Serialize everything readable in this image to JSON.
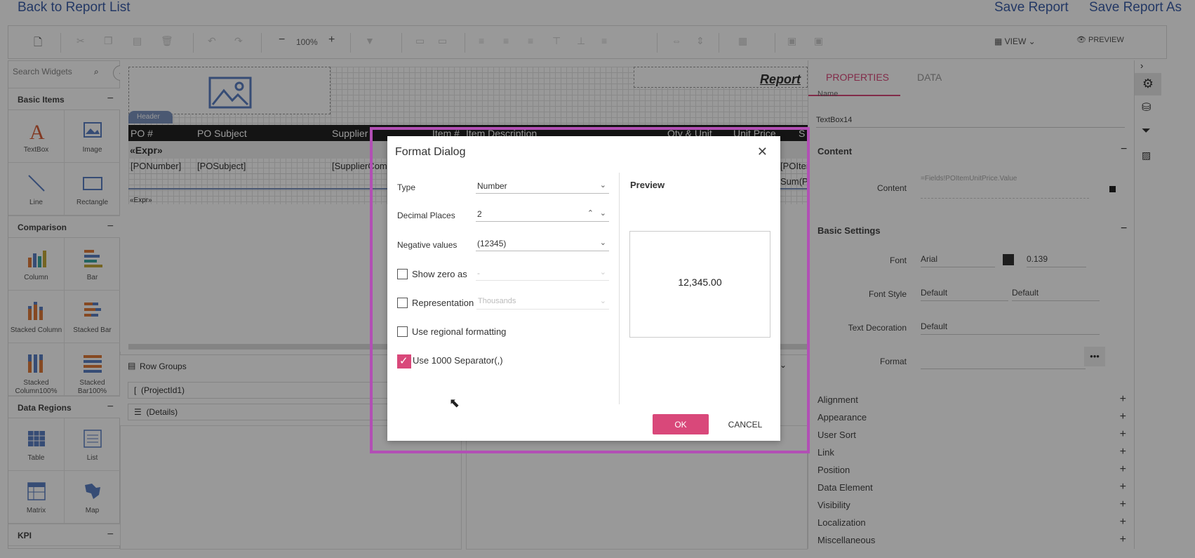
{
  "topbar": {
    "back": "Back to Report List",
    "save": "Save Report",
    "save_as": "Save Report As"
  },
  "toolbar": {
    "zoom": "100%",
    "minus": "−",
    "plus": "+",
    "view": "VIEW",
    "preview": "PREVIEW"
  },
  "left_panel": {
    "search_placeholder": "Search Widgets",
    "sections": [
      "Basic Items",
      "Comparison",
      "Data Regions",
      "KPI"
    ],
    "widgets": {
      "textbox": "TextBox",
      "image": "Image",
      "line": "Line",
      "rectangle": "Rectangle",
      "column": "Column",
      "bar": "Bar",
      "stacked_column": "Stacked Column",
      "stacked_bar": "Stacked Bar",
      "stacked_column100": "Stacked Column100%",
      "stacked_bar100": "Stacked Bar100%",
      "table": "Table",
      "list": "List",
      "matrix": "Matrix",
      "map": "Map"
    }
  },
  "canvas": {
    "report_title": "Report",
    "header_tag": "Header",
    "columns": [
      "PO #",
      "PO Subject",
      "Supplier",
      "Item #",
      "Item Description",
      "Qty & Unit",
      "Unit Price",
      "S"
    ],
    "group_row": "«Expr»",
    "detail_row": [
      "[PONumber]",
      "[POSubject]",
      "[SupplierCom",
      "[POIter"
    ],
    "sum_cell": "Sum(P",
    "footer_expr": "«Expr»"
  },
  "bottom": {
    "row_groups": "Row Groups",
    "group1": "(ProjectId1)",
    "group2": "(Details)"
  },
  "properties": {
    "tabs": [
      "PROPERTIES",
      "DATA"
    ],
    "name_label": "Name",
    "name_value": "TextBox14",
    "content_section": "Content",
    "content_label": "Content",
    "content_value": "=Fields!POItemUnitPrice.Value",
    "basic_section": "Basic Settings",
    "font_label": "Font",
    "font_value": "Arial",
    "font_size": "0.139",
    "font_style_label": "Font Style",
    "font_style_value1": "Default",
    "font_style_value2": "Default",
    "text_decoration_label": "Text Decoration",
    "text_decoration_value": "Default",
    "format_label": "Format",
    "format_btn": "•••",
    "collapsed": [
      "Alignment",
      "Appearance",
      "User Sort",
      "Link",
      "Position",
      "Data Element",
      "Visibility",
      "Localization",
      "Miscellaneous"
    ]
  },
  "dialog": {
    "title": "Format Dialog",
    "type_label": "Type",
    "type_value": "Number",
    "decimal_label": "Decimal Places",
    "decimal_value": "2",
    "negative_label": "Negative values",
    "negative_value": "(12345)",
    "show_zero_label": "Show zero as",
    "show_zero_value": "-",
    "representation_label": "Representation",
    "representation_value": "Thousands",
    "regional_label": "Use regional formatting",
    "separator_label": "Use 1000 Separator(,)",
    "separator_checked": true,
    "preview_title": "Preview",
    "preview_value": "12,345.00",
    "ok": "OK",
    "cancel": "CANCEL"
  },
  "colors": {
    "accent": "#d9487a",
    "link": "#3b5ea8",
    "highlight": "#b24fb5"
  }
}
